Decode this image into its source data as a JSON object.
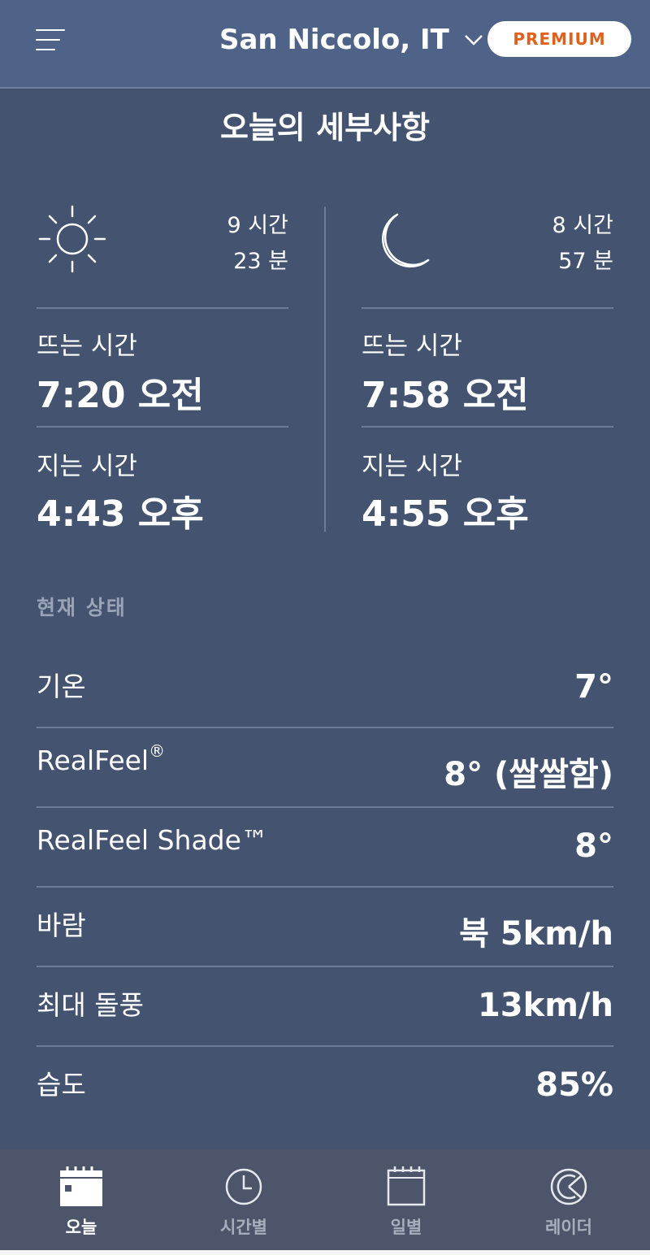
{
  "header": {
    "location": "San Niccolo, IT",
    "premium_label": "PREMIUM"
  },
  "page_title": "오늘의 세부사항",
  "sun": {
    "duration_hours": "9 시간",
    "duration_minutes": "23 분",
    "rise_label": "뜨는 시간",
    "rise_time": "7:20 오전",
    "set_label": "지는 시간",
    "set_time": "4:43 오후"
  },
  "moon": {
    "duration_hours": "8 시간",
    "duration_minutes": "57 분",
    "rise_label": "뜨는 시간",
    "rise_time": "7:58 오전",
    "set_label": "지는 시간",
    "set_time": "4:55 오후"
  },
  "current": {
    "section_label": "현재 상태",
    "rows": [
      {
        "label": "기온",
        "value": "7°"
      },
      {
        "label": "RealFeel",
        "label_sup": "®",
        "value": "8° (쌀쌀함)"
      },
      {
        "label": "RealFeel Shade™",
        "value": "8°"
      },
      {
        "label": "바람",
        "value": "북 5km/h"
      },
      {
        "label": "최대 돌풍",
        "value": "13km/h"
      },
      {
        "label": "습도",
        "value": "85%"
      }
    ]
  },
  "nav": {
    "items": [
      {
        "label": "오늘",
        "icon": "calendar-today-icon"
      },
      {
        "label": "시간별",
        "icon": "clock-icon"
      },
      {
        "label": "일별",
        "icon": "calendar-icon"
      },
      {
        "label": "레이더",
        "icon": "radar-icon"
      }
    ]
  },
  "colors": {
    "background": "#44536f",
    "header": "#4e6387",
    "premium_text": "#e0601e",
    "nav_background": "#4c5569"
  }
}
